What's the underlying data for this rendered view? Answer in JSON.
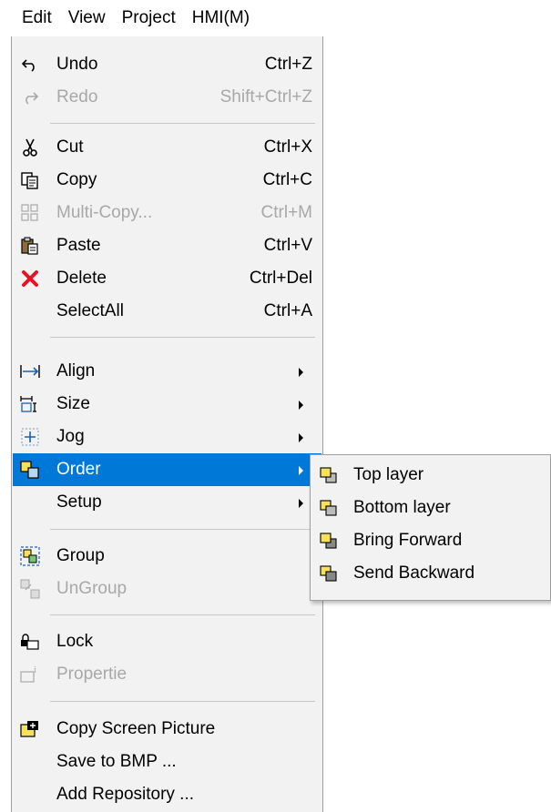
{
  "menubar": {
    "items": [
      "Edit",
      "View",
      "Project",
      "HMI(M)"
    ]
  },
  "edit_menu": {
    "undo": {
      "label": "Undo",
      "shortcut": "Ctrl+Z"
    },
    "redo": {
      "label": "Redo",
      "shortcut": "Shift+Ctrl+Z"
    },
    "cut": {
      "label": "Cut",
      "shortcut": "Ctrl+X"
    },
    "copy": {
      "label": "Copy",
      "shortcut": "Ctrl+C"
    },
    "multi_copy": {
      "label": "Multi-Copy...",
      "shortcut": "Ctrl+M"
    },
    "paste": {
      "label": "Paste",
      "shortcut": "Ctrl+V"
    },
    "delete": {
      "label": "Delete",
      "shortcut": "Ctrl+Del"
    },
    "select_all": {
      "label": "SelectAll",
      "shortcut": "Ctrl+A"
    },
    "align": {
      "label": "Align"
    },
    "size": {
      "label": "Size"
    },
    "jog": {
      "label": "Jog"
    },
    "order": {
      "label": "Order"
    },
    "setup": {
      "label": "Setup"
    },
    "group": {
      "label": "Group"
    },
    "ungroup": {
      "label": "UnGroup"
    },
    "lock": {
      "label": "Lock"
    },
    "propertie": {
      "label": "Propertie"
    },
    "copy_screen_picture": {
      "label": "Copy Screen Picture"
    },
    "save_to_bmp": {
      "label": "Save to BMP ..."
    },
    "add_repository": {
      "label": "Add Repository ..."
    }
  },
  "order_submenu": {
    "top_layer": "Top layer",
    "bottom_layer": "Bottom layer",
    "bring_forward": "Bring Forward",
    "send_backward": "Send Backward"
  },
  "colors": {
    "highlight": "#0078d7",
    "menu_bg": "#f2f2f2",
    "disabled_text": "#a8a8a8",
    "delete_icon": "#e81123"
  }
}
